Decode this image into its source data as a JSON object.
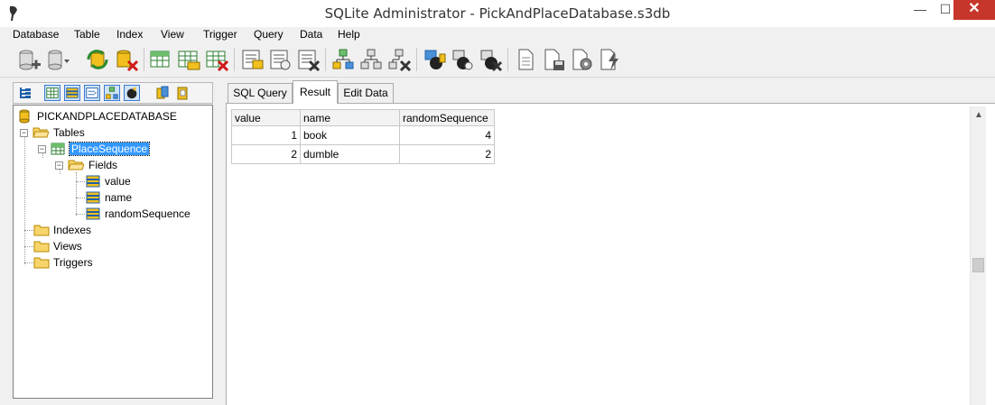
{
  "window": {
    "title": "SQLite Administrator - PickAndPlaceDatabase.s3db",
    "minimize": "—",
    "maximize": "☐",
    "close": "✕"
  },
  "menu": [
    "Database",
    "Table",
    "Index",
    "View",
    "Trigger",
    "Query",
    "Data",
    "Help"
  ],
  "tree": {
    "database": "PICKANDPLACEDATABASE",
    "tables": "Tables",
    "table": "PlaceSequence",
    "fields_label": "Fields",
    "fields": [
      "value",
      "name",
      "randomSequence"
    ],
    "indexes": "Indexes",
    "views": "Views",
    "triggers": "Triggers"
  },
  "tabs": [
    "SQL Query",
    "Result",
    "Edit Data"
  ],
  "active_tab": "Result",
  "result": {
    "columns": [
      "value",
      "name",
      "randomSequence"
    ],
    "rows": [
      [
        "1",
        "book",
        "4"
      ],
      [
        "2",
        "dumble",
        "2"
      ]
    ]
  },
  "colors": {
    "selection": "#3399ff",
    "close_button": "#c7362b",
    "db_icon": "#f2c01e"
  }
}
